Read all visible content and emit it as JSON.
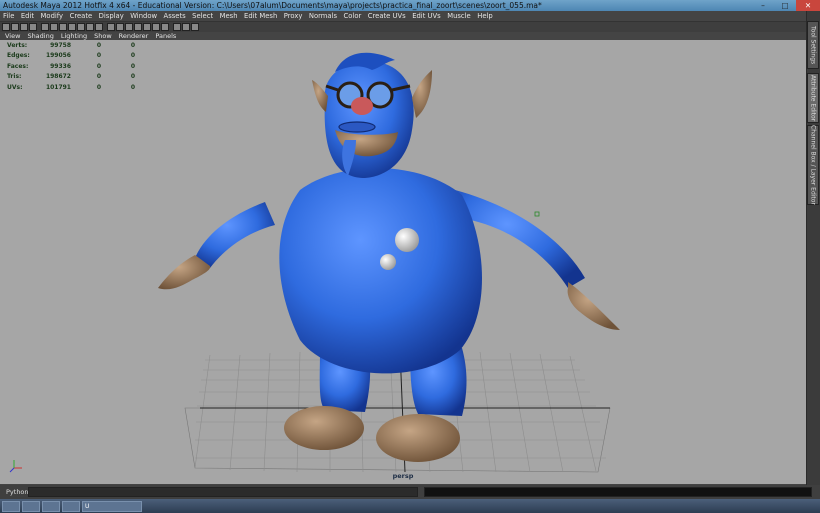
{
  "window": {
    "title": "Autodesk Maya 2012 Hotfix 4 x64 - Educational Version: C:\\Users\\07alum\\Documents\\maya\\projects\\practica_final_zoort\\scenes\\zoort_055.ma*"
  },
  "menubar": [
    "File",
    "Edit",
    "Modify",
    "Create",
    "Display",
    "Window",
    "Assets",
    "Select",
    "Mesh",
    "Edit Mesh",
    "Proxy",
    "Normals",
    "Color",
    "Create UVs",
    "Edit UVs",
    "Muscle",
    "Help"
  ],
  "panel_menu": [
    "View",
    "Shading",
    "Lighting",
    "Show",
    "Renderer",
    "Panels"
  ],
  "side_tabs": [
    "Tool Settings",
    "Attribute Editor",
    "Channel Box / Layer Editor"
  ],
  "hud": {
    "rows": [
      {
        "label": "Verts:",
        "v1": "99758",
        "v2": "0",
        "v3": "0"
      },
      {
        "label": "Edges:",
        "v1": "199056",
        "v2": "0",
        "v3": "0"
      },
      {
        "label": "Faces:",
        "v1": "99336",
        "v2": "0",
        "v3": "0"
      },
      {
        "label": "Tris:",
        "v1": "198672",
        "v2": "0",
        "v3": "0"
      },
      {
        "label": "UVs:",
        "v1": "101791",
        "v2": "0",
        "v3": "0"
      }
    ]
  },
  "viewport": {
    "camera": "persp",
    "background_color": "#a6a6a6",
    "character_color": "#2f6bdf",
    "skin_color": "#9a7d5f"
  },
  "commandline": {
    "label": "Python"
  },
  "taskbar": {
    "items": [
      "",
      "",
      "",
      "",
      "U"
    ]
  }
}
